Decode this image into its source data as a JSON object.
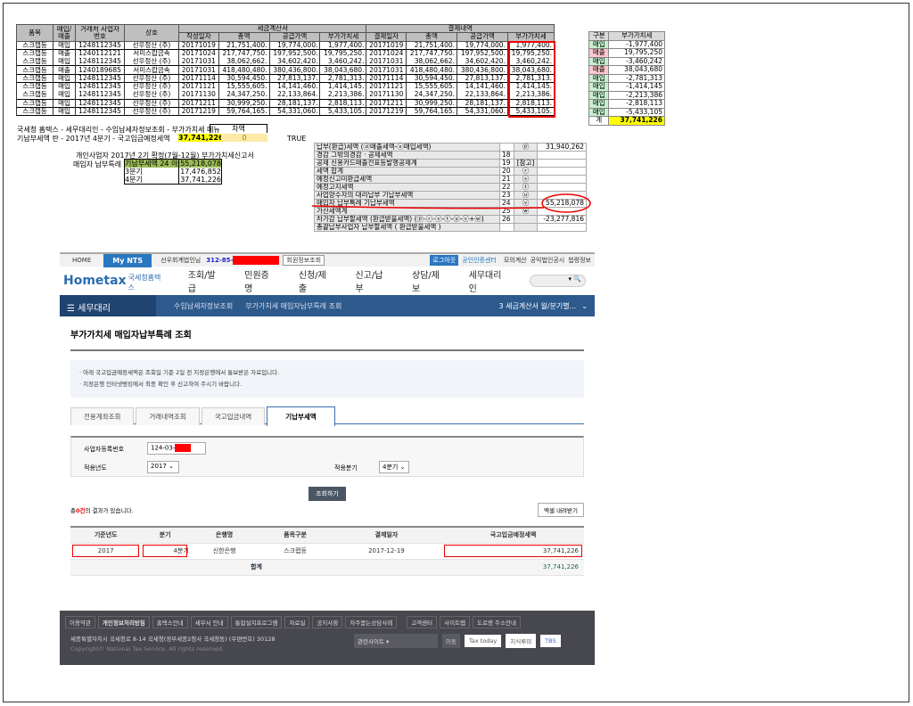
{
  "sheet": {
    "headers": {
      "item": "품목",
      "type": "매입/매출",
      "biz_no": "거래처 사업자번호",
      "company": "상호",
      "invoice_group": "세금계산서",
      "payment_group": "결제내역",
      "date": "작성일자",
      "total": "총액",
      "supply": "공급가액",
      "vat": "부가가치세",
      "pay_date": "결제일자"
    },
    "rows": [
      [
        "스크랩등",
        "매입",
        "1248112345",
        "선우정산 (주)",
        "20171019",
        "21,751,400.",
        "19,774,000.",
        "1,977,400.",
        "20171019",
        "21,751,400.",
        "19,774,000.",
        "1,977,400."
      ],
      [
        "스크랩등",
        "매출",
        "1240112121",
        "서미스랍금속",
        "20171024",
        "217,747,750.",
        "197,952,500.",
        "19,795,250.",
        "20171024",
        "217,747,750.",
        "197,952,500.",
        "19,795,250."
      ],
      [
        "스크랩등",
        "매입",
        "1248112345",
        "선우정산 (주)",
        "20171031",
        "38,062,662.",
        "34,602,420.",
        "3,460,242.",
        "20171031",
        "38,062,662.",
        "34,602,420.",
        "3,460,242."
      ],
      [
        "스크랩등",
        "매출",
        "1240189685",
        "서미스랍금속",
        "20171031",
        "418,480,480.",
        "380,436,800.",
        "38,043,680.",
        "20171031",
        "418,480,480.",
        "380,436,800.",
        "38,043,680."
      ],
      [
        "스크랩등",
        "매입",
        "1248112345",
        "선우정산 (주)",
        "20171114",
        "30,594,450.",
        "27,813,137.",
        "2,781,313.",
        "20171114",
        "30,594,450.",
        "27,813,137.",
        "2,781,313."
      ],
      [
        "스크랩등",
        "매입",
        "1248112345",
        "선우정산 (주)",
        "20171121",
        "15,555,605.",
        "14,141,460.",
        "1,414,145.",
        "20171121",
        "15,555,605.",
        "14,141,460.",
        "1,414,145."
      ],
      [
        "스크랩등",
        "매입",
        "1248112345",
        "선우정산 (주)",
        "20171130",
        "24,347,250.",
        "22,133,864.",
        "2,213,386.",
        "20171130",
        "24,347,250.",
        "22,133,864.",
        "2,213,386."
      ],
      [
        "스크랩등",
        "매입",
        "1248112345",
        "선우정산 (주)",
        "20171211",
        "30,999,250.",
        "28,181,137.",
        "2,818,113.",
        "20171211",
        "30,999,250.",
        "28,181,137.",
        "2,818,113."
      ],
      [
        "스크랩등",
        "매입",
        "1248112345",
        "선우정산 (주)",
        "20171219",
        "59,764,165.",
        "54,331,060.",
        "5,433,105.",
        "20171219",
        "59,764,165.",
        "54,331,060.",
        "5,433,105."
      ]
    ]
  },
  "summary": {
    "headers": {
      "type": "구분",
      "vat": "부가가치세"
    },
    "rows": [
      [
        "매입",
        "-1,977,400"
      ],
      [
        "매출",
        "19,795,250"
      ],
      [
        "매입",
        "-3,460,242"
      ],
      [
        "매출",
        "38,043,680"
      ],
      [
        "매입",
        "-2,781,313"
      ],
      [
        "매입",
        "-1,414,145"
      ],
      [
        "매입",
        "-2,213,386"
      ],
      [
        "매입",
        "-2,818,113"
      ],
      [
        "매입",
        "-5,433,105"
      ]
    ],
    "total_label": "계",
    "total_value": "37,741,226"
  },
  "notes": {
    "line1": "국세청 홈텍스 - 세무대리인 - 수임납세자정보조회 - 부가가치세 메뉴",
    "diff_label": "차액",
    "line2": "기납부세액 란 - 2017년 4분기 - 국고입금예정세액",
    "line2_value": "37,741,226",
    "diff_value": "0",
    "check": "TRUE",
    "report_title": "개인사업자 2017년 2기 확정(7월-12월) 부가가치세신고서",
    "report_label": "매입자 납부특례",
    "report_rows": [
      [
        "기납부세액 24 아",
        "55,218,078"
      ],
      [
        "3분기",
        "17,476,852"
      ],
      [
        "4분기",
        "37,741,226"
      ]
    ]
  },
  "form": {
    "rows": [
      [
        "납부(환급)세액 (ⓓ매출세액-ⓔ매입세액)",
        "",
        "ⓟ",
        "31,940,262"
      ],
      [
        "경감 그밖의경감 · 공제세액",
        "18",
        "",
        ""
      ],
      [
        "공제 신용카드매출전표등발행공제계",
        "19",
        "[참고]",
        ""
      ],
      [
        "세액 합계",
        "20",
        "ⓡ",
        ""
      ],
      [
        "예정신고미환급세액",
        "21",
        "ⓢ",
        ""
      ],
      [
        "예정고지세액",
        "22",
        "ⓣ",
        ""
      ],
      [
        "사업양수자의 대리납부 기납부세액",
        "23",
        "ⓤ",
        ""
      ],
      [
        "매입자 납부특례 기납부세액",
        "24",
        "ⓥ",
        "55,218,078"
      ],
      [
        "가산세액계",
        "25",
        "ⓦ",
        ""
      ],
      [
        "차가감 납부할세액 (환급받을세액) (ⓟ-ⓡ-ⓢ-ⓣ-ⓤ-ⓥ+ⓦ)",
        "26",
        "",
        "-23,277,816"
      ],
      [
        "총괄납부사업자 납부할세액 ( 환급받을세액 )",
        "",
        "",
        ""
      ]
    ]
  },
  "hometax": {
    "top": {
      "home": "HOME",
      "mynts": "My NTS",
      "user": "선우회계법인님",
      "user_no": "312-85-",
      "member_info": "회원정보조회",
      "logout": "로그아웃",
      "cert": "공인인증센터",
      "links": [
        "모의계산",
        "공익법인공시",
        "법령정보"
      ]
    },
    "logo": "Hometax",
    "logo_sub": "국세청홈택스",
    "menu": [
      "조회/발급",
      "민원증명",
      "신청/제출",
      "신고/납부",
      "상담/제보",
      "세무대리인"
    ],
    "breadcrumb": {
      "home": "세무대리",
      "step1": "수임납세자정보조회",
      "step2": "부가가치세 매입자납부특례 조회",
      "right": "3 세금계산서 월/분기별..."
    },
    "page_title": "부가가치세 매입자납부특례 조회",
    "info": [
      "· 아래 국고입금예정세액은 조회일 기준 2일 전 지정은행에서 통보받은 자료입니다.",
      "· 지정은행 인터넷뱅킹에서 최종 확인 후 신고하여 주시기 바랍니다."
    ],
    "tabs": [
      "전용계좌조회",
      "거래내역조회",
      "국고입금내역",
      "기납부세액"
    ],
    "form": {
      "biz_label": "사업자등록번호",
      "biz_value": "124-03-",
      "year_label": "적용년도",
      "year_value": "2017",
      "quarter_label": "적용분기",
      "quarter_value": "4분기"
    },
    "search_btn": "조회하기",
    "result_prefix": "총",
    "result_count": "0건",
    "result_suffix": "의 결과가 있습니다.",
    "excel_btn": "엑셀 내려받기",
    "table": {
      "headers": [
        "기준년도",
        "분기",
        "은행명",
        "품목구분",
        "결제일자",
        "국고입금예정세액"
      ],
      "row": [
        "2017",
        "4분기",
        "신한은행",
        "스크랩등",
        "2017-12-19",
        "37,741,226"
      ],
      "total_label": "합계",
      "total_value": "37,741,226"
    },
    "footer": {
      "links": [
        "이용약관",
        "개인정보처리방침",
        "홈택스안내",
        "세무서 안내",
        "통합설치프로그램",
        "자료실",
        "공지사항",
        "자주묻는상담사례",
        "고객센터",
        "사이트맵",
        "도로명 주소안내"
      ],
      "address": "세종특별자치시 국세청로 8-14 국세청(정부세종2청사 국세청동) (우편번호) 30128",
      "copyright": "Copyright© National Tax Service. All rights reserved.",
      "related": "관련사이트",
      "go": "이동",
      "banners": [
        "Tax today",
        "지식루미",
        "TBS"
      ]
    }
  }
}
